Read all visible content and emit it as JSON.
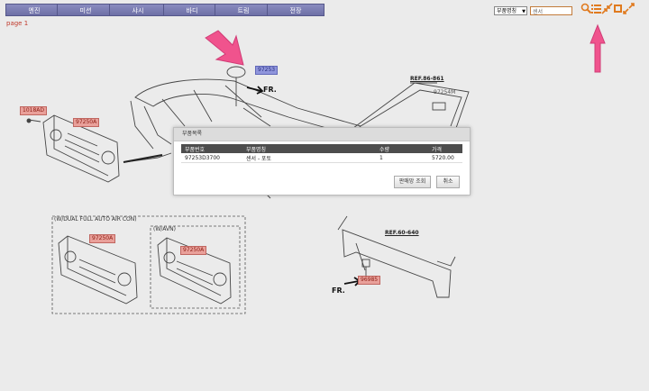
{
  "nav": {
    "tabs": [
      "엔진",
      "미션",
      "샤시",
      "바디",
      "트림",
      "전장"
    ]
  },
  "search": {
    "category_selected": "부품명칭",
    "query": "센서"
  },
  "page_label": "page 1",
  "diagram": {
    "part_labels": {
      "p97253": "97253",
      "p1018ad": "1018AD",
      "p97250a_1": "97250A",
      "p97250a_2": "97250A",
      "p97250a_3": "97250A",
      "p97254m": "97254M",
      "p96985": "96985"
    },
    "refs": {
      "ref_top": "REF.86-861",
      "ref_bottom": "REF.60-640"
    },
    "fr_labels": [
      "FR.",
      "FR."
    ],
    "box_labels": {
      "auto_air": "(W/DUAL FULL AUTO AIR CON)",
      "avn": "(W/AVN)"
    }
  },
  "modal": {
    "title": "부품목록",
    "columns": [
      "부품번호",
      "부품명칭",
      "수량",
      "가격"
    ],
    "rows": [
      {
        "part_no": "97253D3700",
        "name": "센서 - 포토",
        "qty": "1",
        "price": "5720.00"
      }
    ],
    "buttons": {
      "dealer": "판매망 조회",
      "cancel": "취소"
    }
  },
  "colors": {
    "tab": "#6d6fa6",
    "part_red": "#e9a09a",
    "part_blue": "#8f95dc",
    "arrow_pink": "#f0538d",
    "icon_orange": "#e07a1e"
  },
  "icons": [
    "search-icon",
    "list-icon",
    "shrink-icon",
    "fit-icon",
    "expand-icon"
  ]
}
